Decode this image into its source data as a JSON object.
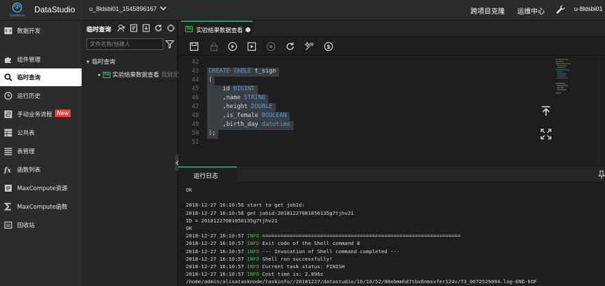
{
  "app": {
    "logo_text": "DataWorks",
    "title": "DataStudio",
    "project": "u_8ldsbi01_1545896167"
  },
  "topnav": {
    "clone": "跨项目克隆",
    "ops": "运维中心",
    "user": "u-8ldsbi01"
  },
  "sidebar": {
    "items": [
      {
        "label": "数据开发",
        "icon": "code-icon"
      },
      {
        "label": "组件管理",
        "icon": "puzzle-icon"
      },
      {
        "label": "临时查询",
        "icon": "search-icon",
        "active": true
      },
      {
        "label": "运行历史",
        "icon": "clock-icon"
      },
      {
        "label": "手动业务流程",
        "icon": "flow-icon",
        "badge": "New"
      },
      {
        "label": "公共表",
        "icon": "table-icon"
      },
      {
        "label": "表管理",
        "icon": "list-icon"
      },
      {
        "label": "函数列表",
        "icon": "function-icon"
      },
      {
        "label": "MaxCompute资源",
        "icon": "resource-icon"
      },
      {
        "label": "MaxCompute函数",
        "icon": "sigma-icon"
      },
      {
        "label": "回收站",
        "icon": "trash-icon"
      }
    ]
  },
  "query_panel": {
    "title": "临时查询",
    "search_placeholder": "文件名称/创建人",
    "folder": "临时查询",
    "file": {
      "badge": "Sq",
      "name": "实验结果数据查看",
      "status": "我锁定"
    }
  },
  "editor": {
    "tab": {
      "badge": "Sq",
      "label": "实验结果数据查看"
    },
    "lines": [
      {
        "n": "42",
        "text": ""
      },
      {
        "n": "43",
        "kw": "CREATE TABLE",
        "text": " t_sign"
      },
      {
        "n": "44",
        "text": "("
      },
      {
        "n": "45",
        "pre": "    id ",
        "kw": "BIGINT",
        "text": ""
      },
      {
        "n": "46",
        "pre": "    ,name ",
        "kw": "STRING",
        "text": ""
      },
      {
        "n": "47",
        "pre": "    ,height ",
        "kw": "DOUBLE",
        "text": ""
      },
      {
        "n": "48",
        "pre": "    ,is_female ",
        "kw": "BOOLEAN",
        "text": ""
      },
      {
        "n": "49",
        "pre": "    ,birth_day ",
        "kw": "datetime",
        "text": ""
      },
      {
        "n": "50",
        "text": ");"
      },
      {
        "n": "51",
        "text": ""
      }
    ]
  },
  "log": {
    "tab_label": "运行日志",
    "lines": [
      {
        "text": "OK"
      },
      {
        "text": ""
      },
      {
        "text": "2018-12-27 16:10:56 start to get jobId:"
      },
      {
        "text": "2018-12-27 16:10:56 get jobid:20181227081056135g7tjhv21"
      },
      {
        "text": "ID = 20181227081056135g7tjhv21"
      },
      {
        "text": "OK"
      },
      {
        "pre": "2018-12-27 16:10:57 ",
        "level": "INFO",
        "text": " ================================================================="
      },
      {
        "pre": "2018-12-27 16:10:57 ",
        "level": "INFO",
        "text": " Exit code of the Shell command 0"
      },
      {
        "pre": "2018-12-27 16:10:57 ",
        "level": "INFO",
        "text": " --- Invocation of Shell command completed ---"
      },
      {
        "pre": "2018-12-27 16:10:57 ",
        "level": "INFO",
        "text": " Shell run successfully!"
      },
      {
        "pre": "2018-12-27 16:10:57 ",
        "level": "INFO",
        "text": " Current task status: FINISH"
      },
      {
        "pre": "2018-12-27 16:10:57 ",
        "level": "INFO",
        "text": " Cost time is: 2.896s"
      },
      {
        "text": "/home/admin/alisatasknode/taskinfo//20181227/datastudio/16/10/52/08ebmmhd7tbx6nmsxfer124v/T3_0672529094.log-END-EOF"
      }
    ]
  },
  "colors": {
    "accent": "#2aa06b",
    "keyword": "#569cd6",
    "info": "#3fbf5a",
    "badge_new": "#e54545"
  }
}
